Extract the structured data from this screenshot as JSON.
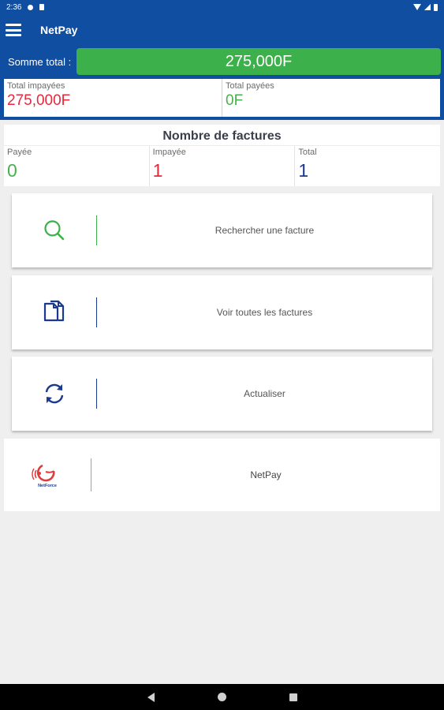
{
  "status_bar": {
    "time": "2:36"
  },
  "app_bar": {
    "title": "NetPay"
  },
  "totals": {
    "somme_label": "Somme total :",
    "somme_value": "275,000F",
    "impayees_label": "Total impayées",
    "impayees_value": "275,000F",
    "payees_label": "Total payées",
    "payees_value": "0F"
  },
  "factures_count": {
    "title": "Nombre de factures",
    "payee_label": "Payée",
    "payee_value": "0",
    "impayee_label": "Impayée",
    "impayee_value": "1",
    "total_label": "Total",
    "total_value": "1"
  },
  "actions": [
    {
      "label": "Rechercher une facture",
      "icon": "search-icon"
    },
    {
      "label": "Voir toutes les factures",
      "icon": "documents-icon"
    },
    {
      "label": "Actualiser",
      "icon": "refresh-icon"
    }
  ],
  "brand": {
    "label": "NetPay",
    "logo_text": "NetForce"
  },
  "colors": {
    "primary": "#0f4ea0",
    "accent_green": "#3cb04a",
    "unpaid_red": "#e8283c",
    "total_navy": "#1a3a8f"
  }
}
